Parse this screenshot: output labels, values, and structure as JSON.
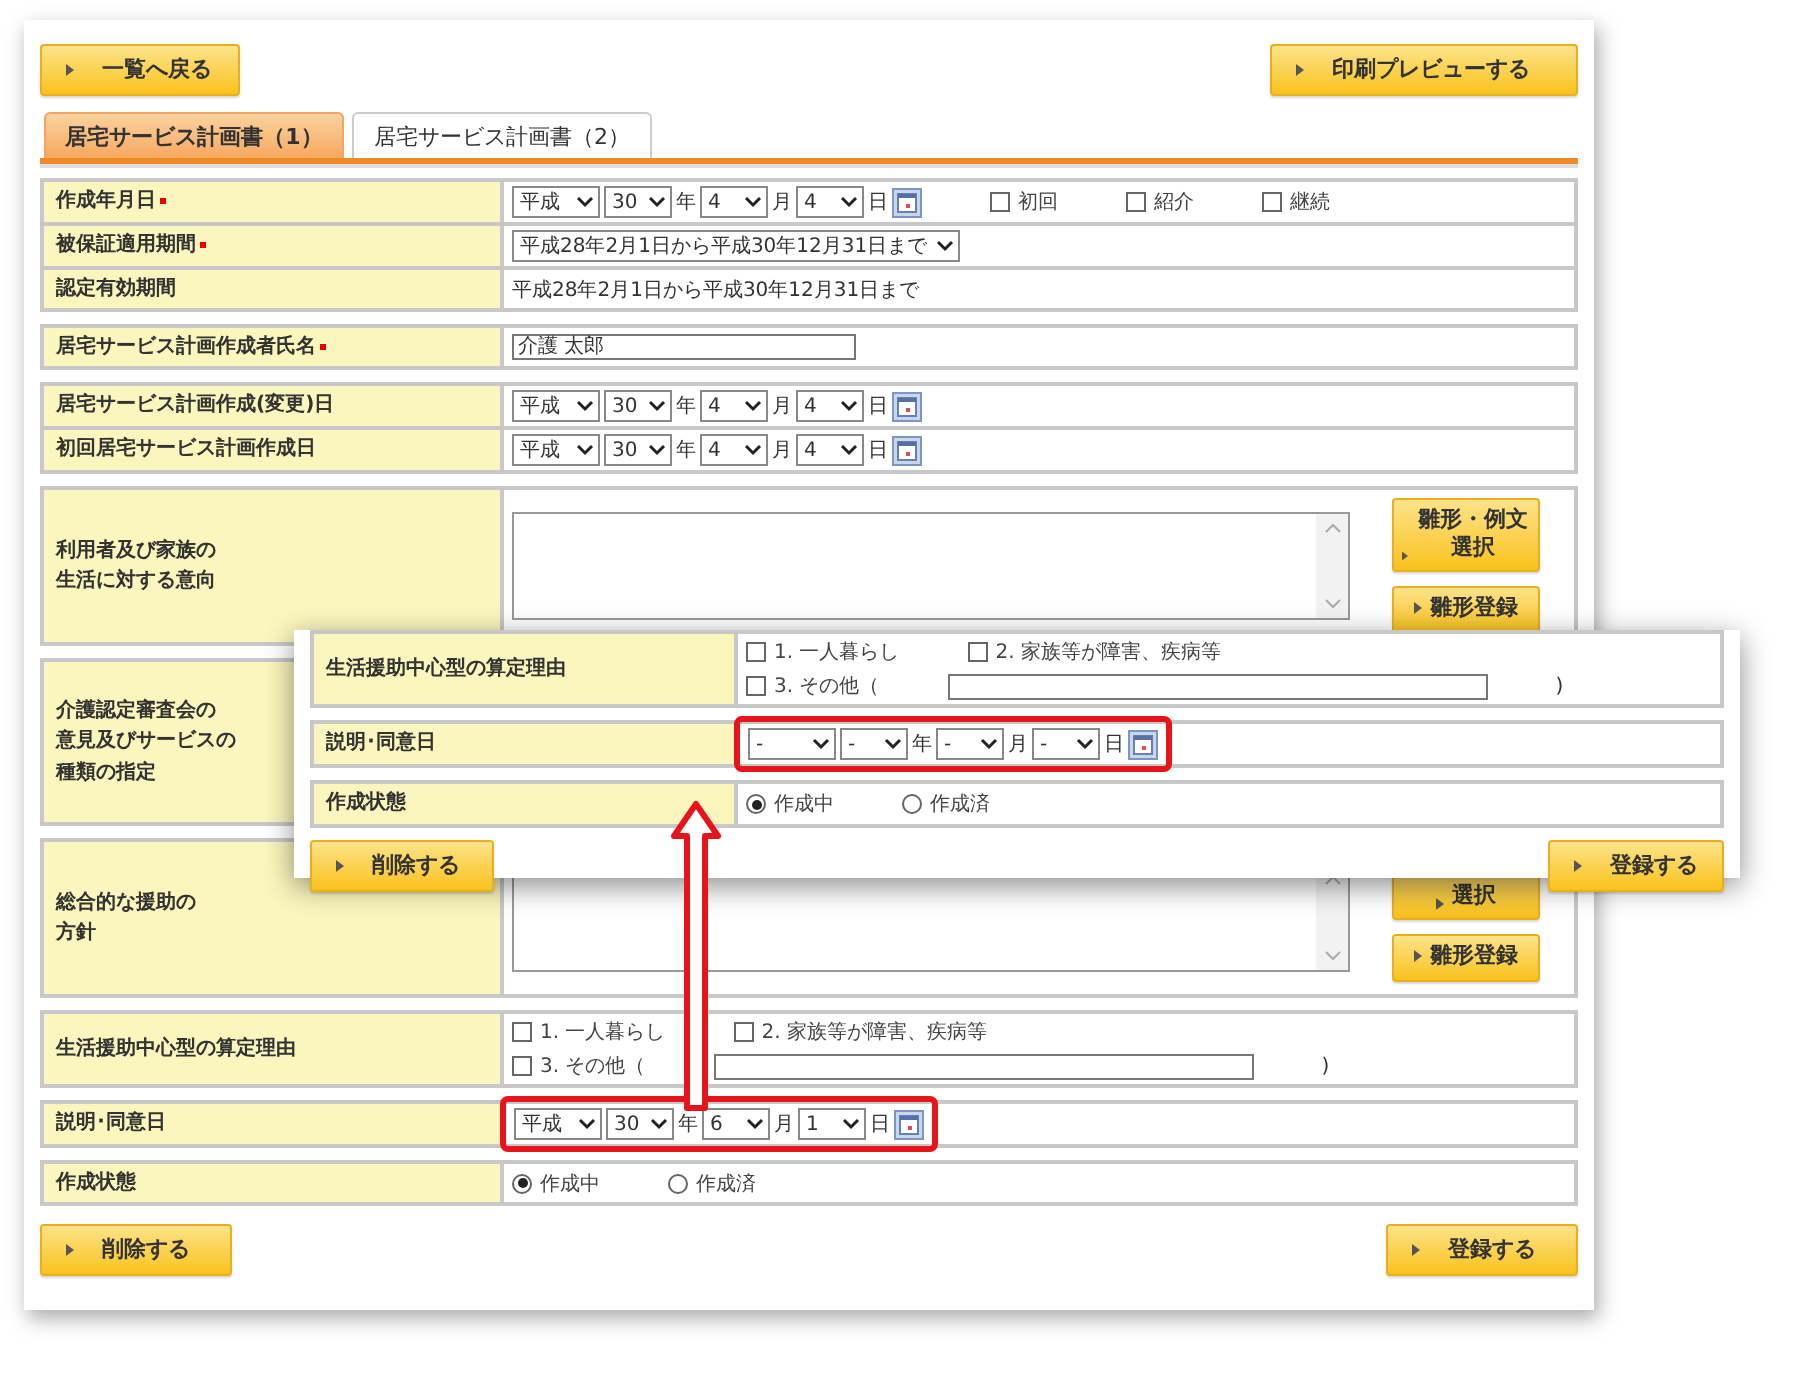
{
  "back_button": "一覧へ戻る",
  "print_button": "印刷プレビューする",
  "tabs": [
    {
      "label": "居宅サービス計画書（1）",
      "selected": true
    },
    {
      "label": "居宅サービス計画書（2）",
      "selected": false
    }
  ],
  "sections": [
    {
      "rows": [
        {
          "label": [
            "作成年月日"
          ],
          "required": true,
          "lines": [
            [
              {
                "kind": "date",
                "highlighted": false,
                "parts": [
                  {
                    "value": "平成"
                  },
                  {
                    "value": "30",
                    "suffix": "年"
                  },
                  {
                    "value": "4",
                    "suffix": "月"
                  },
                  {
                    "value": "4",
                    "suffix": "日"
                  }
                ]
              },
              {
                "kind": "checkbox",
                "label": "初回",
                "checked": false
              },
              {
                "kind": "checkbox",
                "label": "紹介",
                "checked": false
              },
              {
                "kind": "checkbox",
                "label": "継続",
                "checked": false
              }
            ]
          ]
        },
        {
          "label": [
            "被保証適用期間"
          ],
          "required": true,
          "lines": [
            [
              {
                "kind": "select",
                "value": "平成28年2月1日から平成30年12月31日まで"
              }
            ]
          ]
        },
        {
          "label": [
            "認定有効期間"
          ],
          "required": false,
          "lines": [
            [
              {
                "kind": "text",
                "text": "平成28年2月1日から平成30年12月31日まで"
              }
            ]
          ]
        }
      ]
    },
    {
      "rows": [
        {
          "label": [
            "居宅サービス計画作成者氏名"
          ],
          "required": true,
          "lines": [
            [
              {
                "kind": "input",
                "value": "介護 太郎"
              }
            ]
          ]
        }
      ]
    },
    {
      "rows": [
        {
          "label": [
            "居宅サービス計画作成(変更)日"
          ],
          "required": false,
          "lines": [
            [
              {
                "kind": "date",
                "highlighted": false,
                "parts": [
                  {
                    "value": "平成"
                  },
                  {
                    "value": "30",
                    "suffix": "年"
                  },
                  {
                    "value": "4",
                    "suffix": "月"
                  },
                  {
                    "value": "4",
                    "suffix": "日"
                  }
                ]
              }
            ]
          ]
        },
        {
          "label": [
            "初回居宅サービス計画作成日"
          ],
          "required": false,
          "lines": [
            [
              {
                "kind": "date",
                "highlighted": false,
                "parts": [
                  {
                    "value": "平成"
                  },
                  {
                    "value": "30",
                    "suffix": "年"
                  },
                  {
                    "value": "4",
                    "suffix": "月"
                  },
                  {
                    "value": "4",
                    "suffix": "日"
                  }
                ]
              }
            ]
          ]
        }
      ]
    },
    {
      "rows": [
        {
          "label": [
            "利用者及び家族の",
            "生活に対する意向"
          ],
          "required": false,
          "lines": [
            [
              {
                "kind": "textarea"
              }
            ]
          ],
          "side_buttons": [
            "雛形・例文選択",
            "雛形登録"
          ]
        }
      ]
    },
    {
      "rows": [
        {
          "label": [
            "介護認定審査会の",
            "意見及びサービスの",
            "種類の指定"
          ],
          "required": false,
          "lines": []
        }
      ]
    },
    {
      "rows": [
        {
          "label": [
            "総合的な援助の",
            "方針"
          ],
          "required": false,
          "lines": [
            [
              {
                "kind": "textarea"
              }
            ]
          ],
          "side_buttons": [
            "選択",
            "雛形登録"
          ]
        }
      ]
    },
    {
      "rows": [
        {
          "label": [
            "生活援助中心型の算定理由"
          ],
          "required": false,
          "lines": [
            [
              {
                "kind": "checkbox",
                "label": "1. 一人暮らし",
                "checked": false
              },
              {
                "kind": "checkbox",
                "label": "2. 家族等が障害、疾病等",
                "checked": false
              }
            ],
            [
              {
                "kind": "checkbox",
                "label": "3. その他（",
                "checked": false
              },
              {
                "kind": "input"
              },
              {
                "kind": "text",
                "text": ")"
              }
            ]
          ]
        }
      ]
    },
    {
      "rows": [
        {
          "label": [
            "説明･同意日"
          ],
          "required": false,
          "lines": [
            [
              {
                "kind": "date",
                "highlighted": true,
                "parts": [
                  {
                    "value": "平成"
                  },
                  {
                    "value": "30",
                    "suffix": "年"
                  },
                  {
                    "value": "6",
                    "suffix": "月"
                  },
                  {
                    "value": "1",
                    "suffix": "日"
                  }
                ]
              }
            ]
          ]
        }
      ]
    },
    {
      "rows": [
        {
          "label": [
            "作成状態"
          ],
          "required": false,
          "lines": [
            [
              {
                "kind": "radio",
                "label": "作成中",
                "selected": true
              },
              {
                "kind": "radio",
                "label": "作成済",
                "selected": false
              }
            ]
          ]
        }
      ]
    }
  ],
  "delete_button": "削除する",
  "register_button": "登録する",
  "inset": {
    "sections": [
      {
        "rows": [
          {
            "label": [
              "生活援助中心型の算定理由"
            ],
            "required": false,
            "lines": [
              [
                {
                  "kind": "checkbox",
                  "label": "1. 一人暮らし",
                  "checked": false
                },
                {
                  "kind": "checkbox",
                  "label": "2. 家族等が障害、疾病等",
                  "checked": false
                }
              ],
              [
                {
                  "kind": "checkbox",
                  "label": "3. その他（",
                  "checked": false
                },
                {
                  "kind": "input"
                },
                {
                  "kind": "text",
                  "text": ")"
                }
              ]
            ]
          }
        ]
      },
      {
        "rows": [
          {
            "label": [
              "説明･同意日"
            ],
            "required": false,
            "lines": [
              [
                {
                  "kind": "date",
                  "highlighted": true,
                  "parts": [
                    {
                      "value": "-"
                    },
                    {
                      "value": "-",
                      "suffix": "年"
                    },
                    {
                      "value": "-",
                      "suffix": "月"
                    },
                    {
                      "value": "-",
                      "suffix": "日"
                    }
                  ]
                }
              ]
            ]
          }
        ]
      },
      {
        "rows": [
          {
            "label": [
              "作成状態"
            ],
            "required": false,
            "lines": [
              [
                {
                  "kind": "radio",
                  "label": "作成中",
                  "selected": true
                },
                {
                  "kind": "radio",
                  "label": "作成済",
                  "selected": false
                }
              ]
            ]
          }
        ]
      }
    ],
    "delete_button": "削除する",
    "register_button": "登録する"
  }
}
